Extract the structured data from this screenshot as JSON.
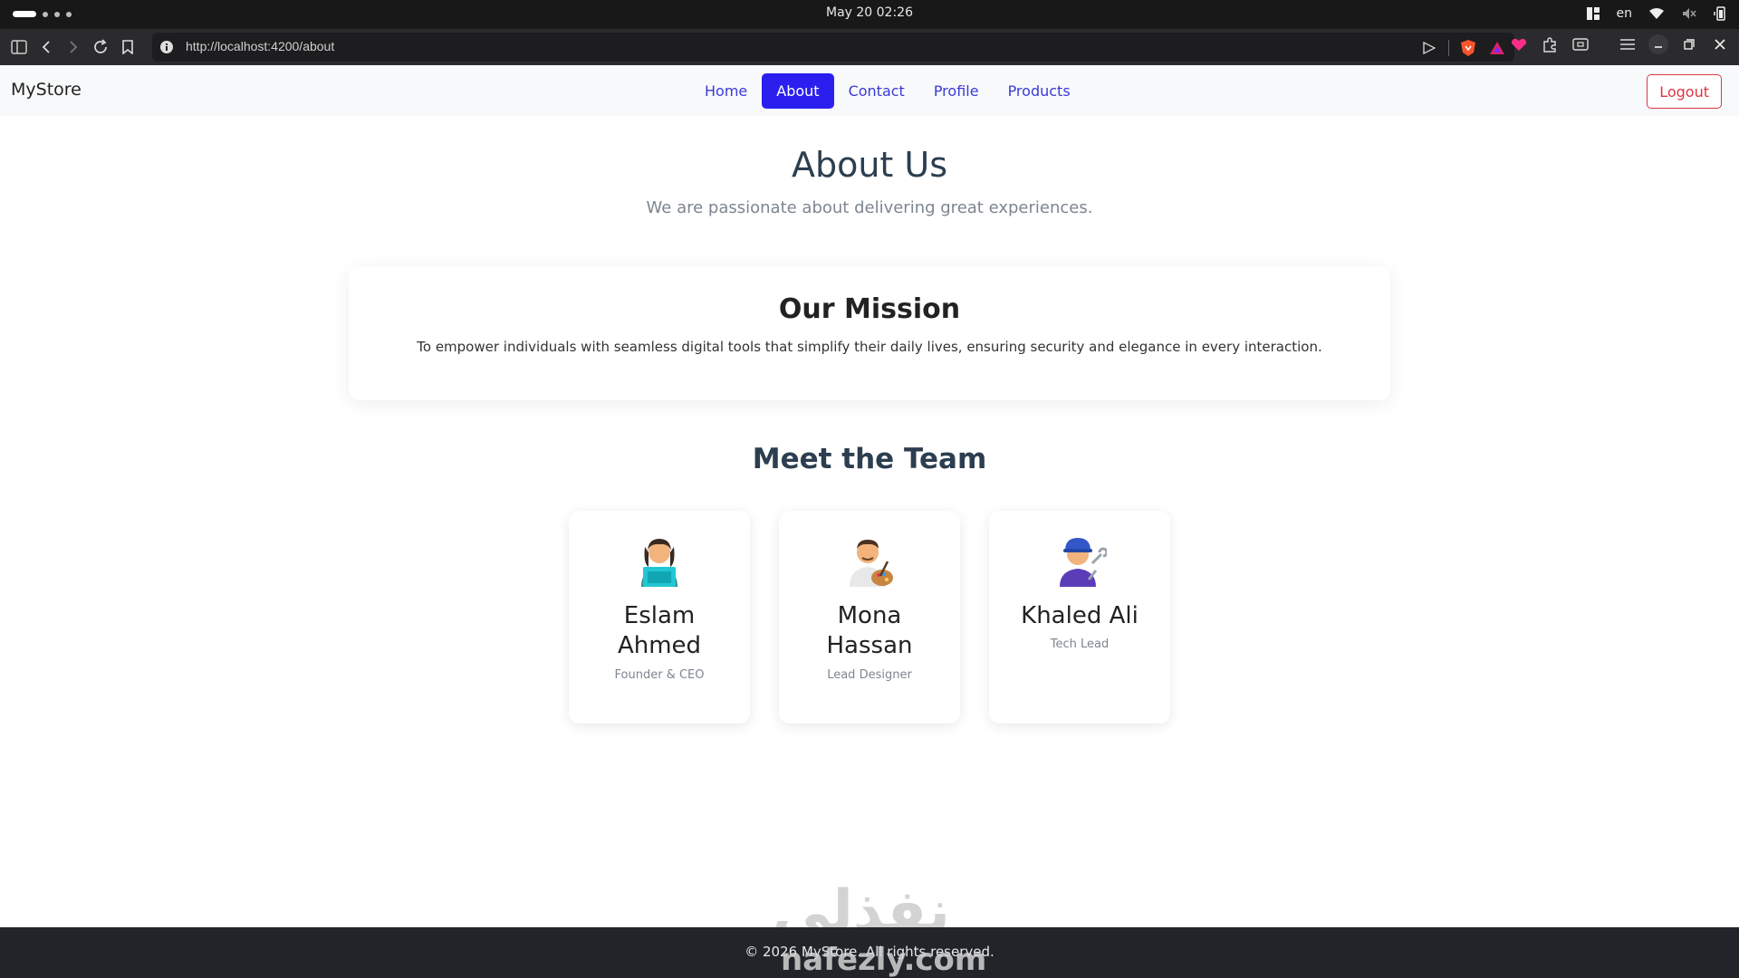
{
  "os": {
    "clock": "May 20  02:26",
    "language": "en"
  },
  "browser": {
    "url": "http://localhost:4200/about"
  },
  "nav": {
    "brand": "MyStore",
    "links": [
      {
        "label": "Home",
        "active": false
      },
      {
        "label": "About",
        "active": true
      },
      {
        "label": "Contact",
        "active": false
      },
      {
        "label": "Profile",
        "active": false
      },
      {
        "label": "Products",
        "active": false
      }
    ],
    "logout_label": "Logout"
  },
  "hero": {
    "title": "About Us",
    "subtitle": "We are passionate about delivering great experiences."
  },
  "mission": {
    "title": "Our Mission",
    "text": "To empower individuals with seamless digital tools that simplify their daily lives, ensuring security and elegance in every interaction."
  },
  "team": {
    "title": "Meet the Team",
    "members": [
      {
        "name": "Eslam Ahmed",
        "role": "Founder & CEO",
        "avatar_icon": "technologist-icon"
      },
      {
        "name": "Mona Hassan",
        "role": "Lead Designer",
        "avatar_icon": "artist-icon"
      },
      {
        "name": "Khaled Ali",
        "role": "Tech Lead",
        "avatar_icon": "mechanic-icon"
      }
    ]
  },
  "footer": {
    "text": "© 2026 MyStore. All rights reserved."
  },
  "watermark": {
    "arabic": "نفذلي",
    "latin": "nafezly.com"
  },
  "colors": {
    "primary": "#2b1ff0",
    "danger": "#dc3545",
    "footer_bg": "#212529"
  }
}
